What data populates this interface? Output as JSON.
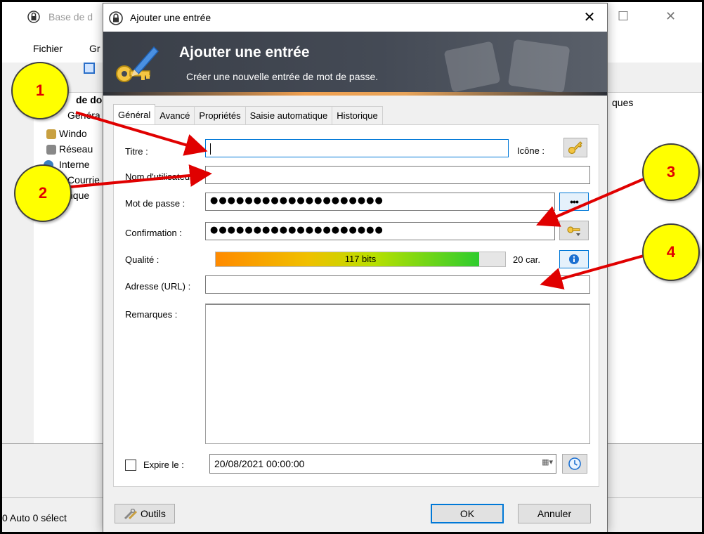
{
  "background_window": {
    "title": "Base de d",
    "menu": [
      "Fichier",
      "Gr"
    ],
    "tree_header": "de do",
    "tree_items": [
      "Généra",
      "Windo",
      "Réseau",
      "Interne",
      "Courrie",
      "nque"
    ],
    "list_column": "ques",
    "status_text": "0 Auto 0 sélect"
  },
  "dialog": {
    "title": "Ajouter une entrée",
    "close_label": "✕",
    "banner": {
      "title": "Ajouter une entrée",
      "subtitle": "Créer une nouvelle entrée de mot de passe."
    },
    "tabs": [
      {
        "label": "Général",
        "active": true
      },
      {
        "label": "Avancé",
        "active": false
      },
      {
        "label": "Propriétés",
        "active": false
      },
      {
        "label": "Saisie automatique",
        "active": false
      },
      {
        "label": "Historique",
        "active": false
      }
    ],
    "form": {
      "title_label": "Titre :",
      "title_value": "",
      "icon_label": "Icône :",
      "username_label": "Nom d'utilisateur :",
      "username_value": "",
      "password_label": "Mot de passe :",
      "password_value": "●●●●●●●●●●●●●●●●●●●●",
      "confirm_label": "Confirmation :",
      "confirm_value": "●●●●●●●●●●●●●●●●●●●●",
      "quality_label": "Qualité :",
      "quality_text": "117 bits",
      "quality_fraction": 0.91,
      "char_count": "20 car.",
      "url_label": "Adresse (URL) :",
      "url_value": "",
      "notes_label": "Remarques :",
      "notes_value": "",
      "expires_label": "Expire le :",
      "expires_checked": false,
      "expires_value": "20/08/2021 00:00:00"
    },
    "buttons": {
      "tools": "Outils",
      "ok": "OK",
      "cancel": "Annuler"
    }
  },
  "annotations": [
    "1",
    "2",
    "3",
    "4"
  ],
  "colors": {
    "callout_fill": "#ffff00",
    "callout_text": "#e00000",
    "arrow": "#e00000",
    "focus_border": "#0078d7",
    "banner_bg": "#444a55"
  }
}
